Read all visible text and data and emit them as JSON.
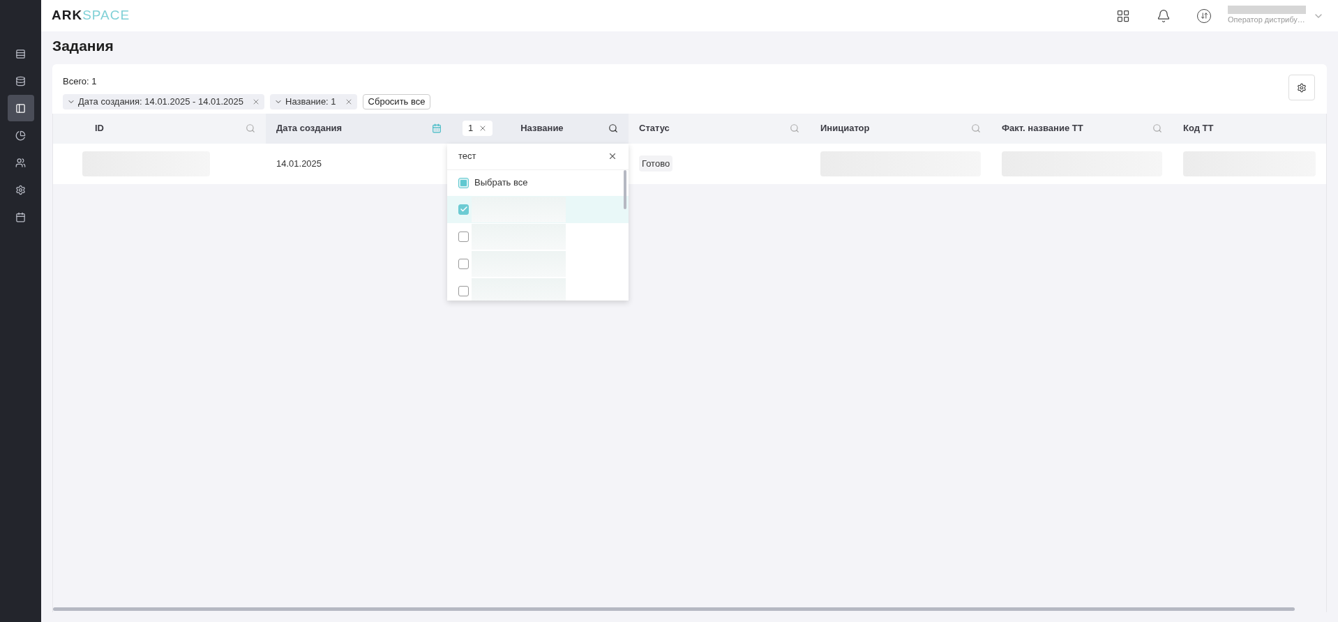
{
  "header": {
    "logo": {
      "part_1": "ARK",
      "part_2": "SPACE"
    },
    "user": {
      "role": "Оператор дистрибу…"
    }
  },
  "sidebar": {
    "items": [
      {
        "kind": "list",
        "selected": false
      },
      {
        "kind": "database",
        "selected": false
      },
      {
        "kind": "panel",
        "selected": true
      },
      {
        "kind": "chart",
        "selected": false
      },
      {
        "kind": "users",
        "selected": false
      },
      {
        "kind": "settings",
        "selected": false
      },
      {
        "kind": "calendar",
        "selected": false
      }
    ]
  },
  "page": {
    "title": "Задания"
  },
  "toolbar": {
    "total": "Всего: 1",
    "filters": [
      {
        "label": "Дата создания: 14.01.2025 - 14.01.2025"
      },
      {
        "label": "Название: 1"
      }
    ],
    "reset_button": "Сбросить все"
  },
  "table": {
    "columns": [
      {
        "label": "ID",
        "kind": "search",
        "filter_active": false
      },
      {
        "label": "Дата создания",
        "kind": "calendar",
        "filter_active": true
      },
      {
        "label": "Название",
        "kind": "search",
        "filter_active": true,
        "filter_tag": "1"
      },
      {
        "label": "Статус",
        "kind": "search",
        "filter_active": false
      },
      {
        "label": "Инициатор",
        "kind": "search",
        "filter_active": false
      },
      {
        "label": "Факт. название ТТ",
        "kind": "search",
        "filter_active": false
      },
      {
        "label": "Код ТТ"
      }
    ],
    "rows": [
      {
        "cells": [
          {
            "kind": "redacted"
          },
          {
            "kind": "text",
            "text": "14.01.2025"
          },
          {
            "kind": "hidden"
          },
          {
            "kind": "tag",
            "text": "Готово"
          },
          {
            "kind": "redacted"
          },
          {
            "kind": "redacted"
          },
          {
            "kind": "redacted"
          }
        ]
      }
    ]
  },
  "filter_dropdown": {
    "search_value": "тест",
    "select_all": {
      "label": "Выбрать все",
      "indeterminate": true
    },
    "options": [
      {
        "checked": true
      },
      {
        "checked": false
      },
      {
        "checked": false
      },
      {
        "checked": false
      }
    ]
  }
}
